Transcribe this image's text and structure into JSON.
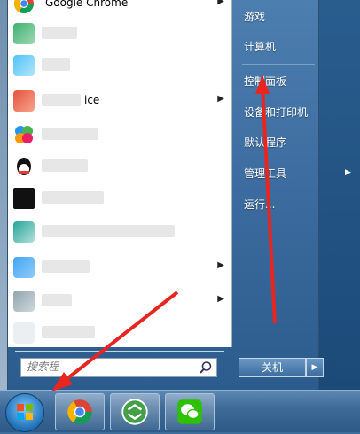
{
  "start_menu": {
    "pinned": [
      {
        "label": "Google Chrome",
        "icon": "chrome-icon",
        "has_submenu": true
      }
    ],
    "recent_programs": [
      {
        "label": "",
        "icon": "app-icon-1",
        "has_submenu": false
      },
      {
        "label": "",
        "icon": "app-icon-2",
        "has_submenu": false
      },
      {
        "label": "ice",
        "icon": "office-icon",
        "has_submenu": true
      },
      {
        "label": "",
        "icon": "colorful-icon",
        "has_submenu": false
      },
      {
        "label": "",
        "icon": "qq-icon",
        "has_submenu": false
      },
      {
        "label": "",
        "icon": "terminal-icon",
        "has_submenu": false
      },
      {
        "label": "",
        "icon": "app-icon-3",
        "has_submenu": false
      },
      {
        "label": "",
        "icon": "app-icon-4",
        "has_submenu": true
      },
      {
        "label": "",
        "icon": "app-icon-5",
        "has_submenu": true
      },
      {
        "label": "",
        "icon": "app-icon-6",
        "has_submenu": false
      }
    ],
    "search": {
      "placeholder": "搜索程"
    },
    "right_pane": {
      "games": "游戏",
      "computer": "计算机",
      "control_panel": "控制面板",
      "devices_printers": "设备和打印机",
      "default_programs": "默认程序",
      "admin_tools": "管理工具",
      "run": "运行..."
    },
    "shutdown_label": "关机"
  },
  "taskbar": {
    "items": [
      "chrome-icon",
      "app-green-icon",
      "wechat-icon"
    ]
  },
  "colors": {
    "annotation_arrow": "#e8261f",
    "menu_blue": "#3a6a9d"
  }
}
